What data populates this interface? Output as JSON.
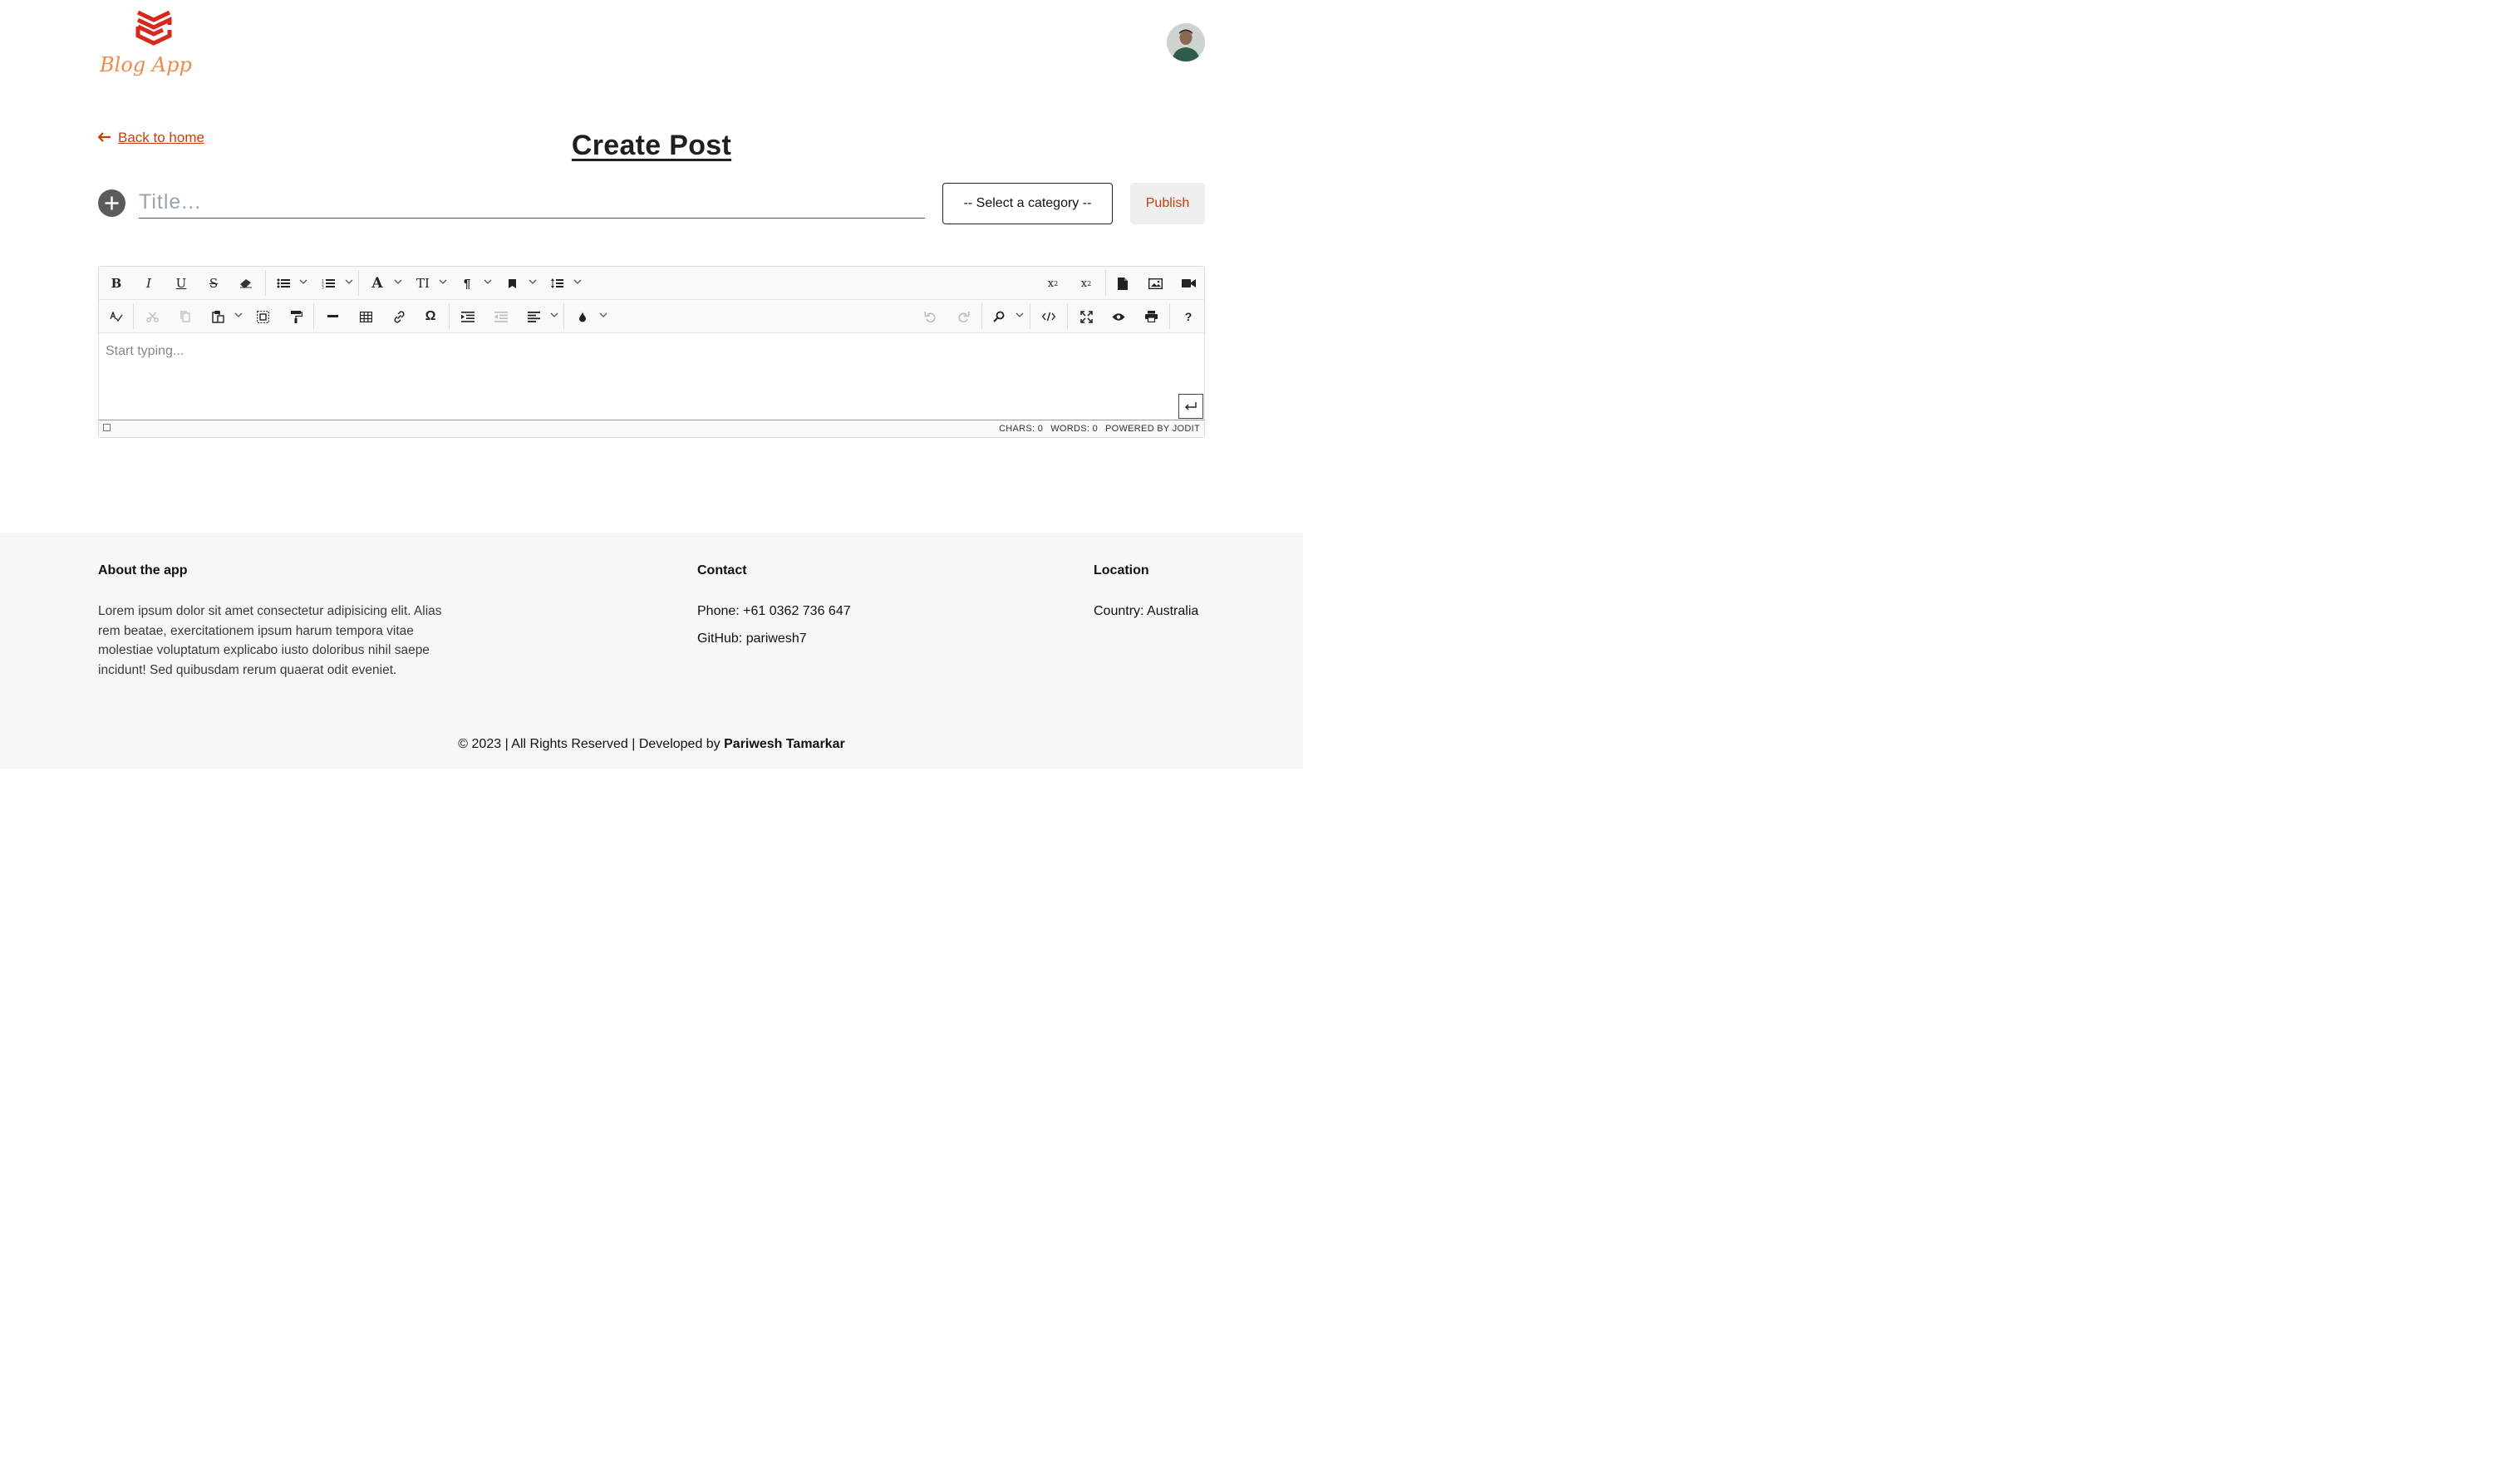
{
  "header": {
    "logo_text": "Blog App",
    "logo_icon": "stacked-layers-icon",
    "avatar_alt": "user-avatar"
  },
  "nav": {
    "back_label": "Back to home",
    "back_icon": "arrow-left-icon"
  },
  "page": {
    "title": "Create Post"
  },
  "form": {
    "add_icon": "plus-circle-icon",
    "title_placeholder": "Title...",
    "category_selected": "-- Select a category --",
    "publish_label": "Publish"
  },
  "editor": {
    "toolbar_row1_left": [
      "bold-icon",
      "italic-icon",
      "underline-icon",
      "strikethrough-icon",
      "eraser-icon",
      "bulleted-list-icon",
      "numbered-list-icon",
      "font-icon",
      "font-size-icon",
      "paragraph-icon",
      "classes-icon",
      "line-height-icon"
    ],
    "toolbar_row1_right": [
      "superscript-icon",
      "subscript-icon",
      "file-icon",
      "image-icon",
      "video-icon"
    ],
    "toolbar_row2_left": [
      "spellcheck-icon",
      "cut-icon",
      "copy-icon",
      "paste-icon",
      "select-all-icon",
      "copy-format-icon",
      "horizontal-rule-icon",
      "table-icon",
      "link-icon",
      "special-char-icon",
      "indent-icon",
      "outdent-icon",
      "align-icon",
      "brush-icon"
    ],
    "toolbar_row2_right": [
      "undo-icon",
      "redo-icon",
      "search-icon",
      "source-icon",
      "fullscreen-icon",
      "preview-icon",
      "print-icon",
      "help-icon"
    ],
    "placeholder": "Start typing...",
    "status": {
      "chars": "CHARS: 0",
      "words": "WORDS: 0",
      "powered": "POWERED BY JODIT"
    }
  },
  "footer": {
    "about_heading": "About the app",
    "about_text": "Lorem ipsum dolor sit amet consectetur adipisicing elit. Alias rem beatae, exercitationem ipsum harum tempora vitae molestiae voluptatum explicabo iusto doloribus nihil saepe incidunt! Sed quibusdam rerum quaerat odit eveniet.",
    "contact_heading": "Contact",
    "phone": "Phone: +61 0362 736 647",
    "github": "GitHub: pariwesh7",
    "location_heading": "Location",
    "country": "Country: Australia",
    "copyright_prefix": "© 2023 | All Rights Reserved | Developed by ",
    "developer": "Pariwesh Tamarkar"
  },
  "colors": {
    "accent": "#c2410c",
    "logo_red": "#d9271d",
    "logo_text": "#f08a4b",
    "footer_bg": "#f6f7f9",
    "publish_bg": "#efefef"
  }
}
